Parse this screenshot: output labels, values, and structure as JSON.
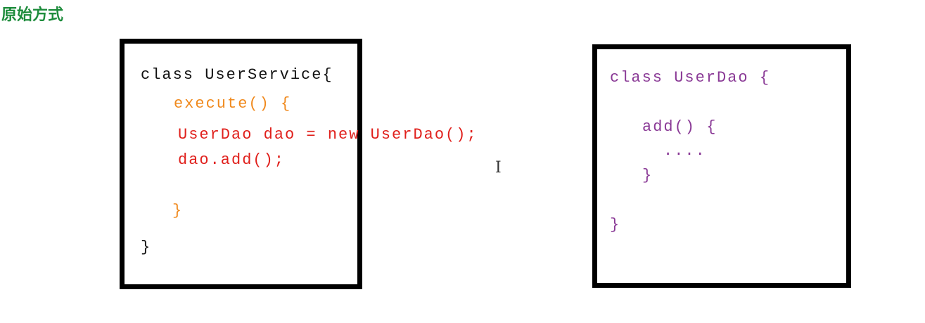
{
  "title": "原始方式",
  "user_service": {
    "lines": [
      "class UserService{",
      "execute() {",
      "UserDao dao = new UserDao();",
      "dao.add();",
      "}",
      "}"
    ]
  },
  "user_dao": {
    "lines": [
      "class UserDao {",
      "add() {",
      "....",
      "}",
      "}"
    ]
  },
  "colors": {
    "title": "#1e8c3c",
    "class": "#111111",
    "method": "#f08a1e",
    "body": "#e0201c",
    "dao": "#8a3a96"
  },
  "cursor_glyph": "I"
}
